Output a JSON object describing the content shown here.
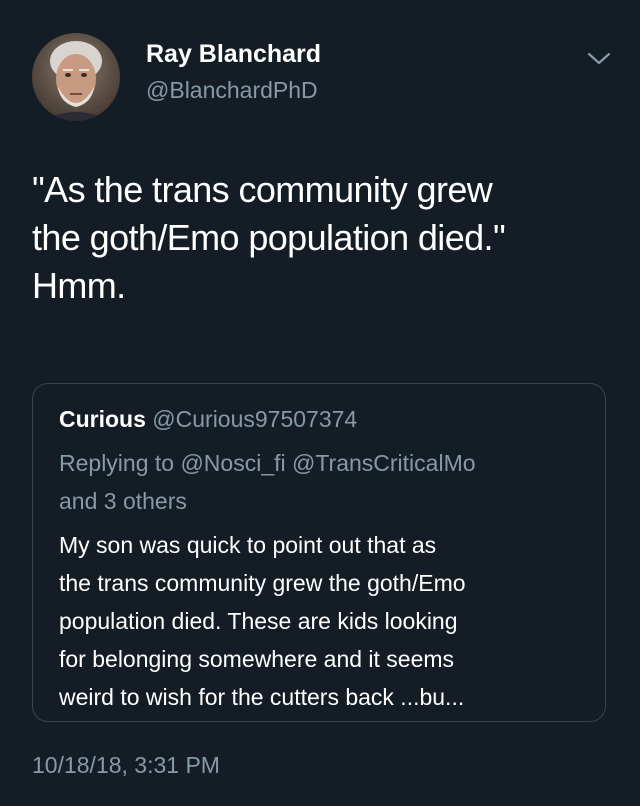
{
  "author": {
    "display_name": "Ray Blanchard",
    "handle": "@BlanchardPhD",
    "avatar_icon": "profile-photo"
  },
  "menu": {
    "icon": "chevron-down-icon"
  },
  "tweet": {
    "text_lines": [
      "\"As the trans community grew",
      "the goth/Emo population died.\"",
      "Hmm."
    ],
    "timestamp": "10/18/18, 3:31 PM"
  },
  "quoted_tweet": {
    "display_name": "Curious",
    "handle": "@Curious97507374",
    "reply_lines": [
      "Replying to @Nosci_fi @TransCriticalMo",
      "and 3 others"
    ],
    "body_lines": [
      "My son was quick to point out that as",
      "the trans community grew the goth/Emo",
      "population died. These are kids looking",
      "for belonging somewhere and it seems",
      "weird to wish for the cutters back ...bu..."
    ]
  },
  "colors": {
    "background": "#141d26",
    "primary_text": "#ffffff",
    "secondary_text": "#8899a6",
    "border": "#38444d"
  }
}
